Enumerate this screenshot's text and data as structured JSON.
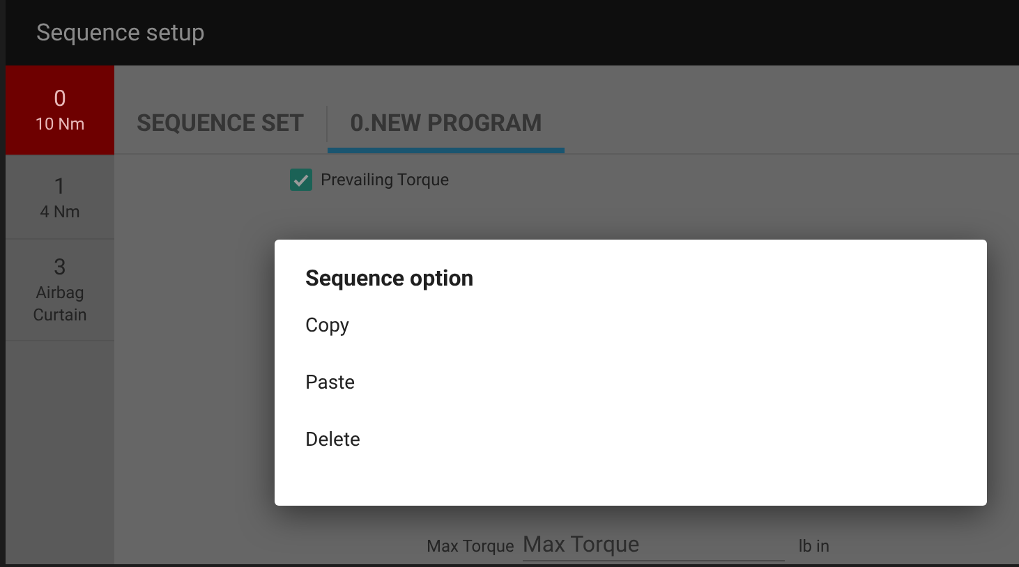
{
  "window": {
    "title": "Sequence setup"
  },
  "sidebar": {
    "items": [
      {
        "number": "0",
        "label": "10 Nm",
        "selected": true
      },
      {
        "number": "1",
        "label": "4 Nm",
        "selected": false
      },
      {
        "number": "3",
        "label": "Airbag Curtain",
        "selected": false
      }
    ]
  },
  "tabs": [
    {
      "label": "SEQUENCE SET",
      "selected": false
    },
    {
      "label": "0.NEW PROGRAM",
      "selected": true
    }
  ],
  "prevailing_torque": {
    "label": "Prevailing Torque",
    "checked": true
  },
  "max_torque": {
    "label": "Max Torque",
    "placeholder": "Max Torque",
    "unit": "lb in"
  },
  "dialog": {
    "title": "Sequence option",
    "options": [
      "Copy",
      "Paste",
      "Delete"
    ]
  }
}
